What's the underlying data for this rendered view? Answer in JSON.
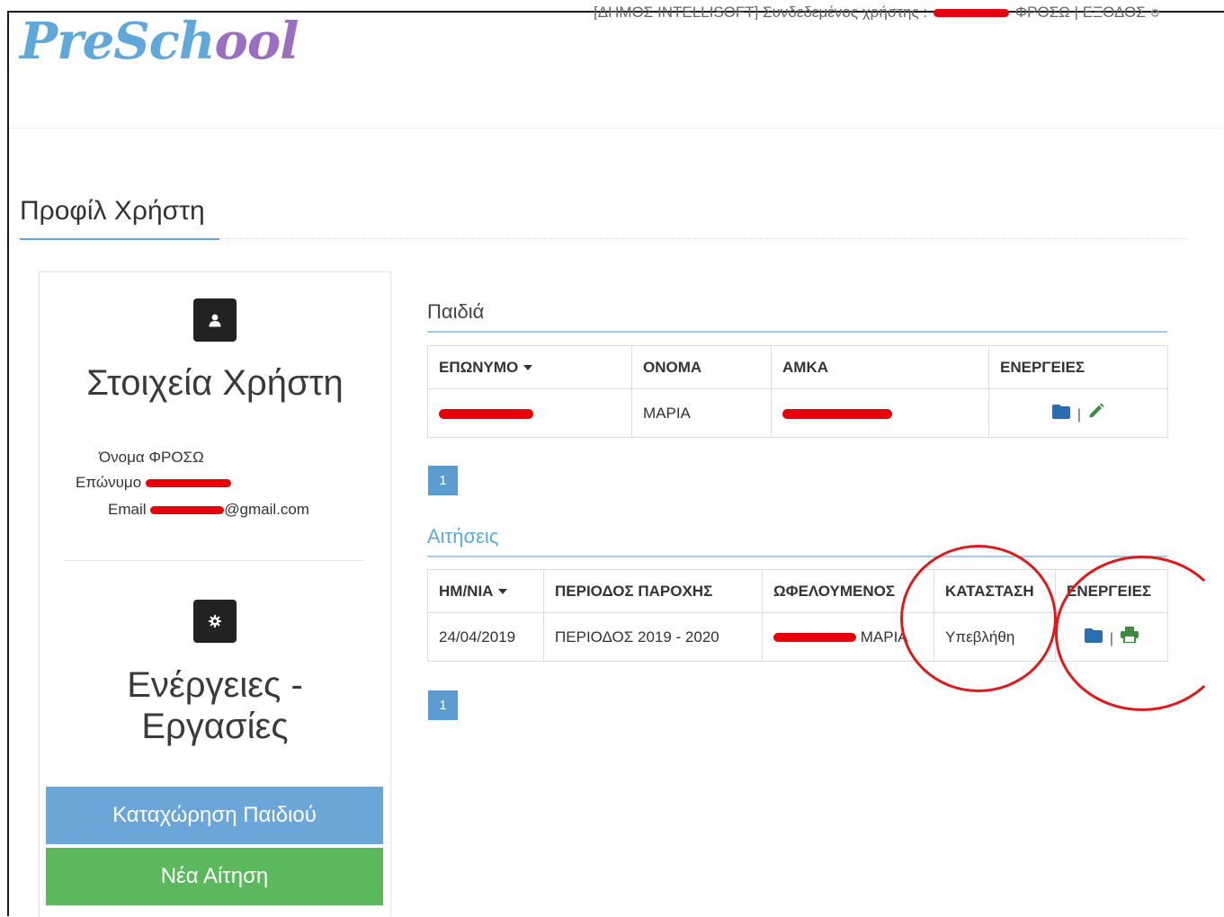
{
  "brand": {
    "logo_part1": "PreSch",
    "logo_part2": "ool"
  },
  "topbar": {
    "text": "[ΔΗΜΟΣ INTELLISOFT] Συνδεδεμένος χρήστης :",
    "user": "ΦΡΟΣΩ",
    "separator": "|",
    "logout": "ΕΞΟΔΟΣ"
  },
  "page": {
    "title": "Προφίλ Χρήστη"
  },
  "profile": {
    "heading": "Στοιχεία Χρήστη",
    "name_label": "Όνομα",
    "name_value": "ΦΡΟΣΩ",
    "surname_label": "Επώνυμο",
    "email_label": "Email",
    "email_suffix": "@gmail.com"
  },
  "actions_panel": {
    "heading_line1": "Ενέργειες -",
    "heading_line2": "Εργασίες",
    "register_child_button": "Καταχώρηση Παιδιού",
    "new_application_button": "Νέα Αίτηση"
  },
  "children": {
    "title": "Παιδιά",
    "headers": [
      "ΕΠΩΝΥΜΟ",
      "ΟΝΟΜΑ",
      "ΑΜΚΑ",
      "ΕΝΕΡΓΕΙΕΣ"
    ],
    "rows": [
      {
        "name": "ΜΑΡΙΑ"
      }
    ],
    "page": "1"
  },
  "applications": {
    "title": "Αιτήσεις",
    "headers": [
      "ΗΜ/ΝΙΑ",
      "ΠΕΡΙΟΔΟΣ ΠΑΡΟΧΗΣ",
      "ΩΦΕΛΟΥΜΕΝΟΣ",
      "ΚΑΤΑΣΤΑΣΗ",
      "ΕΝΕΡΓΕΙΕΣ"
    ],
    "rows": [
      {
        "date": "24/04/2019",
        "period": "ΠΕΡΙΟΔΟΣ 2019 - 2020",
        "beneficiary_name": "ΜΑΡΙΑ",
        "status": "Υπεβλήθη"
      }
    ],
    "page": "1"
  },
  "colors": {
    "accent": "#5fa8d9",
    "brand_purple": "#9a6ec1",
    "primary_button": "#6aa6d8",
    "success_button": "#5cb85c",
    "annotation": "#e01a1a",
    "redaction": "#e8000d"
  },
  "icons": {
    "user": "user-icon",
    "cog": "cog-icon",
    "folder": "folder-icon",
    "edit": "pencil-icon",
    "print": "print-icon",
    "settings": "gear-icon"
  }
}
